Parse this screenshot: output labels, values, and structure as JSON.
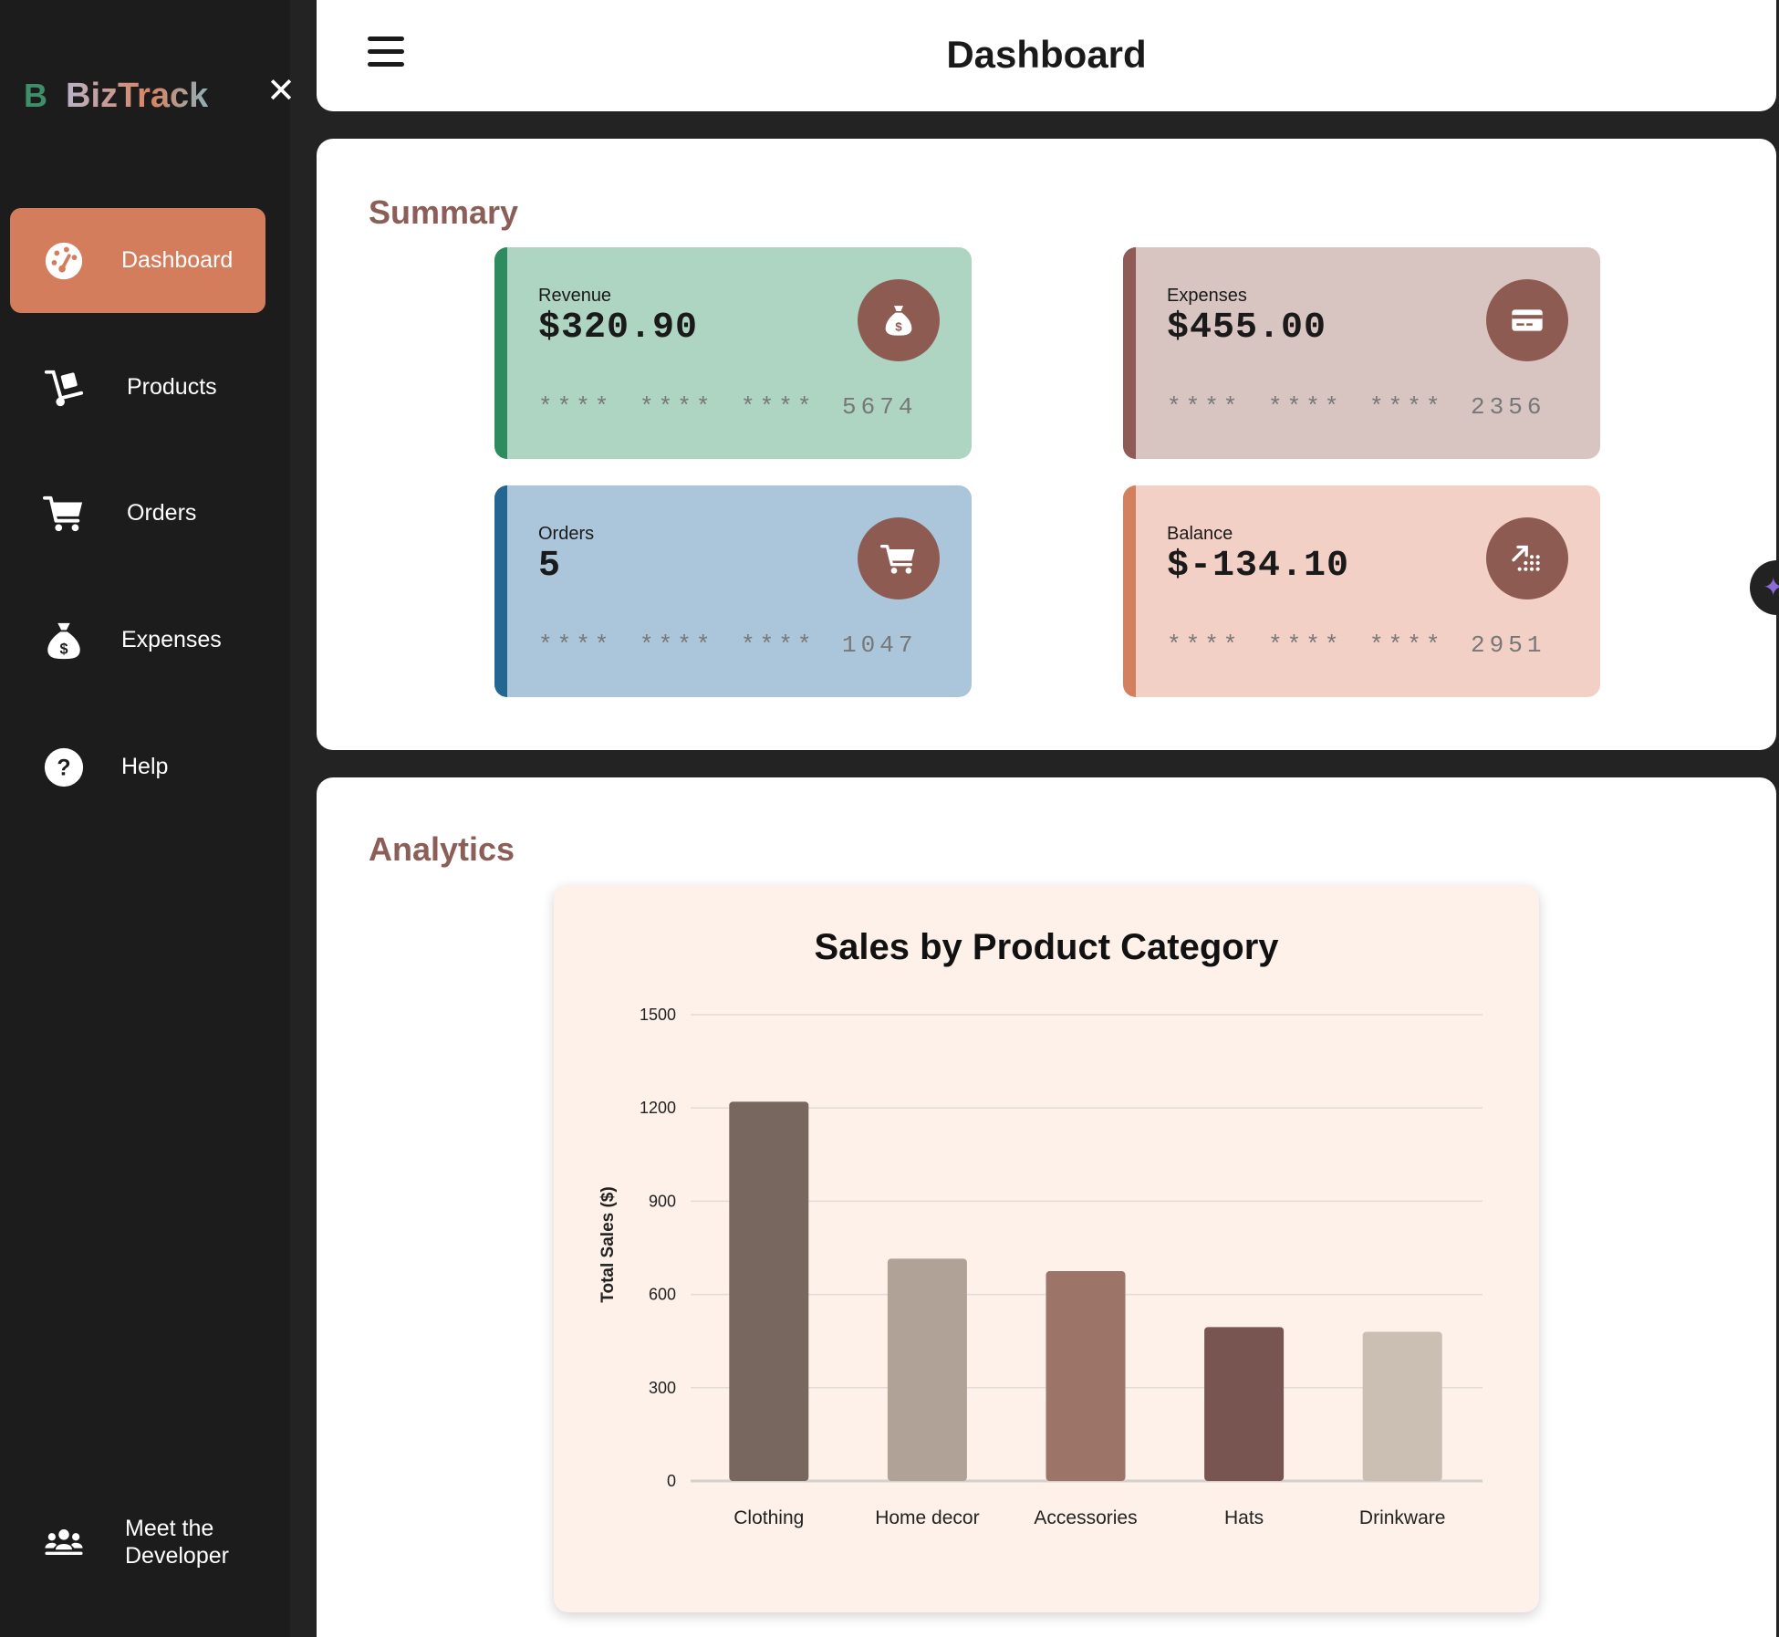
{
  "app": {
    "logo_mark": "B",
    "logo_name": "BizTrack",
    "close_glyph": "✕"
  },
  "sidebar": {
    "items": [
      {
        "label": "Dashboard",
        "icon": "dashboard-gauge-icon",
        "active": true
      },
      {
        "label": "Products",
        "icon": "hand-truck-icon",
        "active": false
      },
      {
        "label": "Orders",
        "icon": "shopping-cart-icon",
        "active": false
      },
      {
        "label": "Expenses",
        "icon": "money-bag-icon",
        "active": false
      },
      {
        "label": "Help",
        "icon": "question-circle-icon",
        "active": false
      }
    ],
    "developer": {
      "label_line1": "Meet the",
      "label_line2": "Developer",
      "icon": "users-group-icon"
    }
  },
  "header": {
    "title": "Dashboard"
  },
  "summary": {
    "title": "Summary",
    "cards": [
      {
        "label": "Revenue",
        "value": "$320.90",
        "mask": "**** **** **** 5674",
        "icon": "money-bag-icon",
        "bg": "#aed4c2",
        "stripe": "#2e8a5f"
      },
      {
        "label": "Expenses",
        "value": "$455.00",
        "mask": "**** **** **** 2356",
        "icon": "credit-card-icon",
        "bg": "#d8c5c2",
        "stripe": "#8e5b57"
      },
      {
        "label": "Orders",
        "value": "5",
        "mask": "**** **** **** 1047",
        "icon": "shopping-cart-icon",
        "bg": "#abc6da",
        "stripe": "#226691"
      },
      {
        "label": "Balance",
        "value": "$-134.10",
        "mask": "**** **** **** 2951",
        "icon": "trend-chart-icon",
        "bg": "#f3d0c5",
        "stripe": "#d4805f"
      }
    ],
    "icon_bg": "#8e5b52"
  },
  "analytics": {
    "title": "Analytics"
  },
  "chart_data": {
    "type": "bar",
    "title": "Sales by Product Category",
    "xlabel": "",
    "ylabel": "Total Sales ($)",
    "categories": [
      "Clothing",
      "Home decor",
      "Accessories",
      "Hats",
      "Drinkware"
    ],
    "values": [
      1220,
      715,
      675,
      495,
      480
    ],
    "colors": [
      "#78675f",
      "#b0a296",
      "#9c7568",
      "#785550",
      "#cbbeb3"
    ],
    "yticks": [
      0,
      300,
      600,
      900,
      1200,
      1500
    ],
    "ylim": [
      0,
      1500
    ],
    "grid": true
  }
}
